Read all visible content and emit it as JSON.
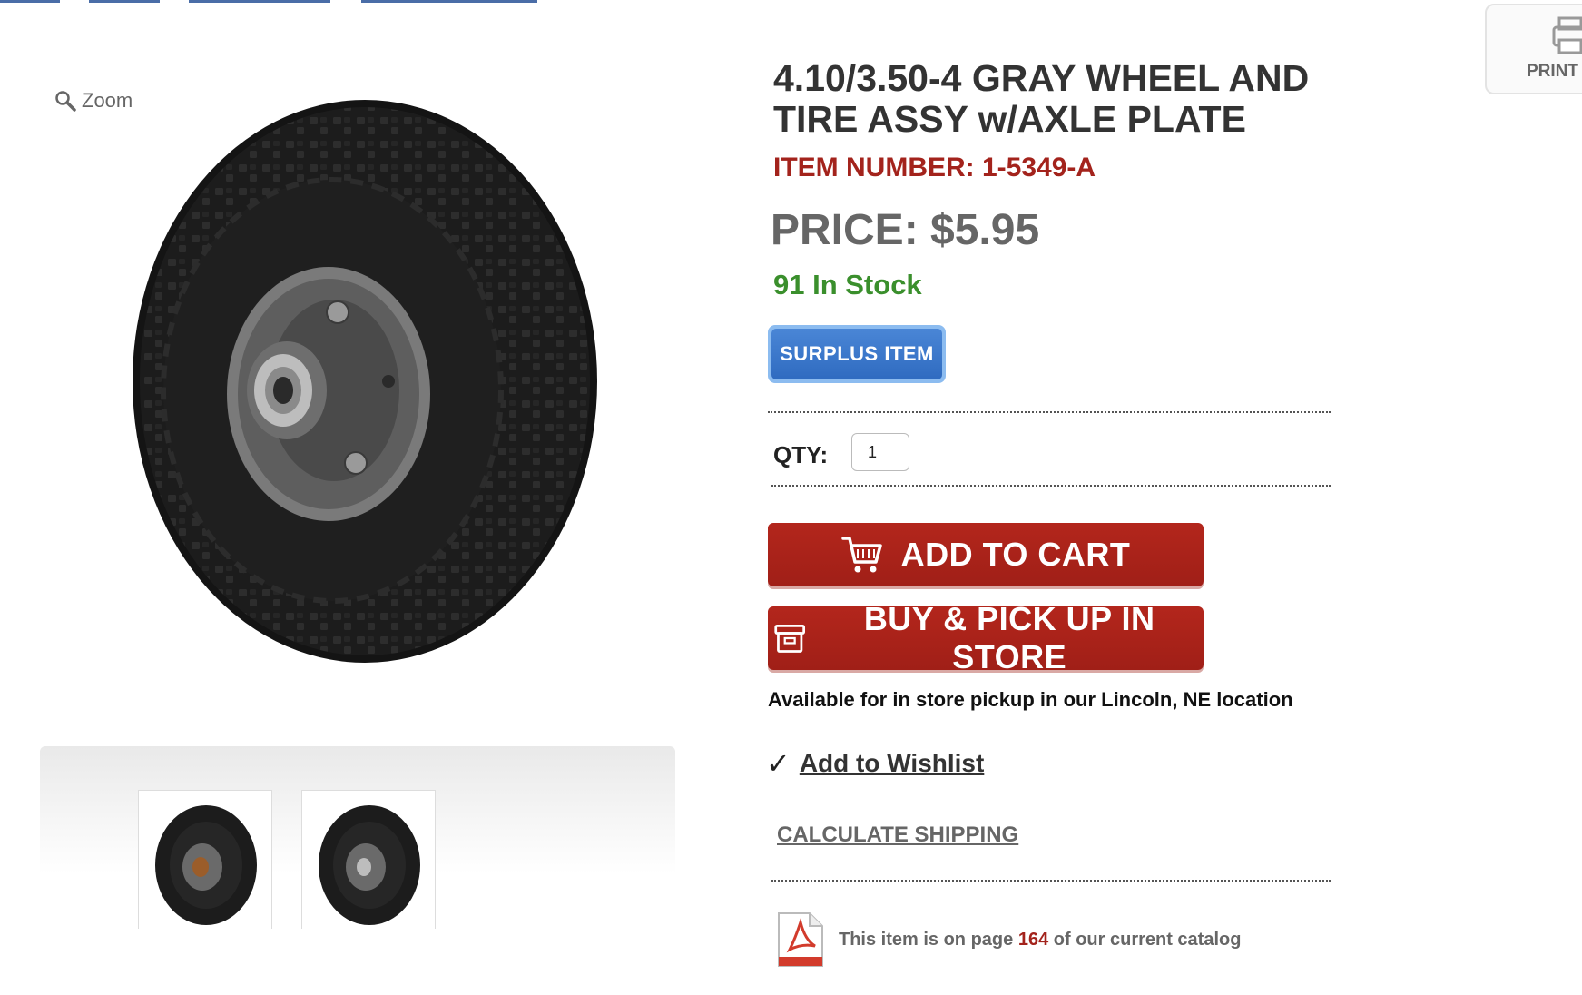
{
  "product": {
    "title": "4.10/3.50-4 GRAY WHEEL AND TIRE ASSY w/AXLE PLATE",
    "item_number": "ITEM NUMBER: 1-5349-A",
    "price": "PRICE: $5.95",
    "stock": "91 In Stock",
    "badge": "SURPLUS ITEM"
  },
  "gallery": {
    "zoom_label": "Zoom",
    "thumbnail_count": 2
  },
  "purchase": {
    "qty_label": "QTY:",
    "qty_value": "1",
    "add_to_cart": "ADD TO CART",
    "buy_pickup": "BUY & PICK UP IN STORE",
    "pickup_note": "Available for in store pickup in our Lincoln, NE location",
    "wishlist": "Add to Wishlist",
    "calculate_shipping": "CALCULATE SHIPPING"
  },
  "catalog": {
    "prefix": "This item is on page",
    "page": "164",
    "suffix": "of our current catalog",
    "pdf_icon": "pdf-icon"
  },
  "print": {
    "label": "PRINT P"
  },
  "colors": {
    "accent_red": "#a3231c",
    "stock_green": "#3a8f2c",
    "badge_blue": "#2f6bc0"
  }
}
